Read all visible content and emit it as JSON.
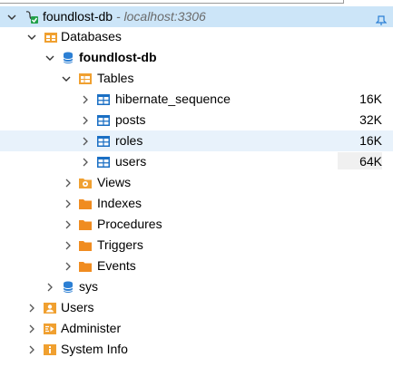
{
  "connection": {
    "name": "foundlost-db",
    "host": "- localhost:3306"
  },
  "databases_label": "Databases",
  "db": {
    "name": "foundlost-db"
  },
  "tables_label": "Tables",
  "tables": [
    {
      "name": "hibernate_sequence",
      "size": "16K"
    },
    {
      "name": "posts",
      "size": "32K"
    },
    {
      "name": "roles",
      "size": "16K"
    },
    {
      "name": "users",
      "size": "64K"
    }
  ],
  "folders": [
    "Views",
    "Indexes",
    "Procedures",
    "Triggers",
    "Events"
  ],
  "sys": "sys",
  "bottom": [
    "Users",
    "Administer",
    "System Info"
  ],
  "colors": {
    "accent_orange": "#f0a030",
    "db_blue": "#2b7fd4",
    "table_blue": "#1a6fc4",
    "selection": "#cce5f8"
  }
}
